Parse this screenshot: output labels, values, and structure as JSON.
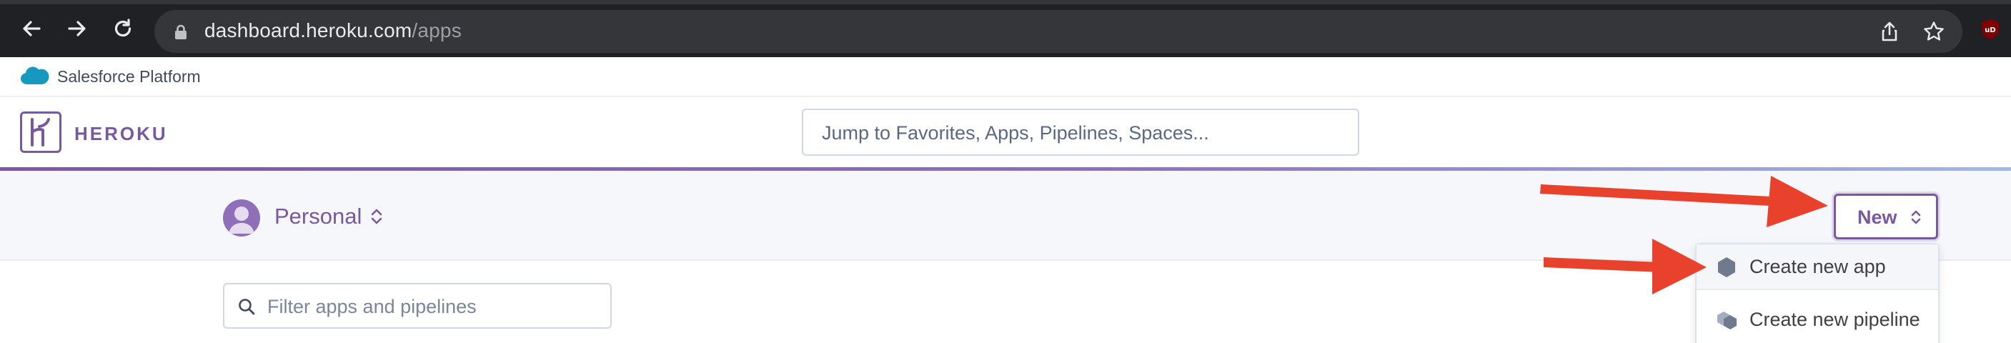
{
  "browser": {
    "url_host": "dashboard.heroku.com",
    "url_path": "/apps",
    "extension_label": "uD"
  },
  "salesforce_bar": {
    "label": "Salesforce Platform"
  },
  "header": {
    "brand": "HEROKU",
    "search_placeholder": "Jump to Favorites, Apps, Pipelines, Spaces..."
  },
  "subheader": {
    "team": "Personal",
    "new_button": "New"
  },
  "main": {
    "filter_placeholder": "Filter apps and pipelines"
  },
  "dropdown": {
    "items": [
      {
        "label": "Create new app",
        "icon": "hexagon-icon"
      },
      {
        "label": "Create new pipeline",
        "icon": "stacked-hexagons-icon"
      }
    ]
  },
  "colors": {
    "brand_purple": "#79589f",
    "annotation_red": "#e8412c",
    "chrome_dark": "#202124"
  }
}
